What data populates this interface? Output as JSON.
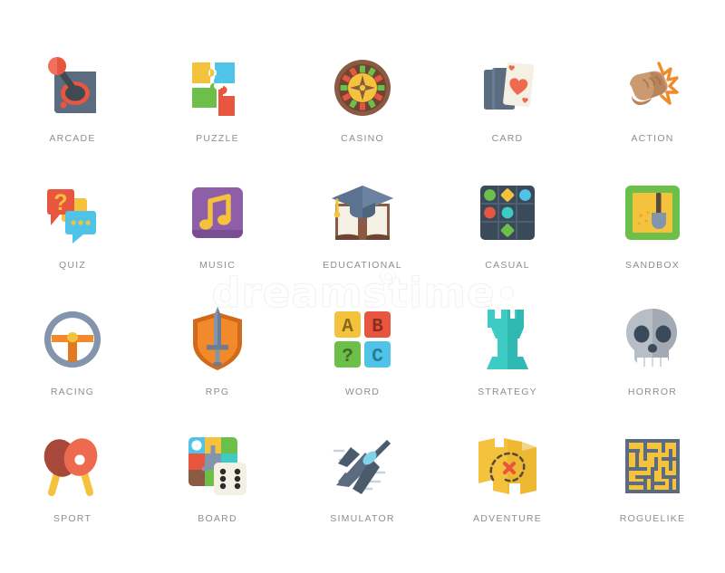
{
  "sheet": {
    "background": "#ffffff",
    "label_color": "#8e8e8e",
    "columns": 5,
    "rows": 4,
    "watermark": {
      "text": "dreamstime",
      "color": "#f2f2f2"
    }
  },
  "icons": [
    {
      "id": "arcade",
      "label": "ARCADE",
      "icon_name": "arcade-joystick-icon",
      "colors": [
        "#5b6b80",
        "#6e7f94",
        "#e8563f",
        "#f0705a",
        "#3f4a52"
      ]
    },
    {
      "id": "puzzle",
      "label": "PUZZLE",
      "icon_name": "puzzle-pieces-icon",
      "colors": [
        "#f4c23c",
        "#4fc3e8",
        "#6cc04a",
        "#e8563f"
      ]
    },
    {
      "id": "casino",
      "label": "CASINO",
      "icon_name": "casino-roulette-icon",
      "colors": [
        "#8a5a42",
        "#6f4432",
        "#f4c23c",
        "#6cc04a",
        "#e8563f"
      ]
    },
    {
      "id": "card",
      "label": "CARD",
      "icon_name": "playing-cards-icon",
      "colors": [
        "#5b6b80",
        "#f4f1e4",
        "#ee6a4e"
      ]
    },
    {
      "id": "action",
      "label": "ACTION",
      "icon_name": "punching-fist-icon",
      "colors": [
        "#cb9a70",
        "#b8845c",
        "#f08a2a"
      ]
    },
    {
      "id": "quiz",
      "label": "QUIZ",
      "icon_name": "quiz-speech-bubbles-icon",
      "colors": [
        "#e8563f",
        "#f4c23c",
        "#4fc3e8"
      ]
    },
    {
      "id": "music",
      "label": "MUSIC",
      "icon_name": "music-note-icon",
      "colors": [
        "#8e5ea8",
        "#7a4f92",
        "#f4c23c"
      ]
    },
    {
      "id": "educational",
      "label": "EDUCATIONAL",
      "icon_name": "graduation-cap-book-icon",
      "colors": [
        "#5b7390",
        "#8a5a42",
        "#f4f1e4",
        "#f4c23c"
      ]
    },
    {
      "id": "casual",
      "label": "CASUAL",
      "icon_name": "match-three-grid-icon",
      "colors": [
        "#3b4a5a",
        "#6cc04a",
        "#f4c23c",
        "#4fc3e8",
        "#e8563f",
        "#3ecbc4"
      ]
    },
    {
      "id": "sandbox",
      "label": "SANDBOX",
      "icon_name": "sandbox-shovel-icon",
      "colors": [
        "#6cc04a",
        "#f4c23c",
        "#5a4a3a"
      ]
    },
    {
      "id": "racing",
      "label": "RACING",
      "icon_name": "steering-wheel-icon",
      "colors": [
        "#97a8bd",
        "#8395ac",
        "#f08a2a",
        "#f4c23c"
      ]
    },
    {
      "id": "rpg",
      "label": "RPG",
      "icon_name": "sword-shield-icon",
      "colors": [
        "#f08a2a",
        "#d16a1c",
        "#8395ac",
        "#6b7d93"
      ]
    },
    {
      "id": "word",
      "label": "WORD",
      "icon_name": "letter-blocks-icon",
      "colors": [
        "#f4c23c",
        "#e8563f",
        "#6cc04a",
        "#4fc3e8"
      ]
    },
    {
      "id": "strategy",
      "label": "STRATEGY",
      "icon_name": "chess-rook-icon",
      "colors": [
        "#3ecbc4",
        "#2fb9b2"
      ]
    },
    {
      "id": "horror",
      "label": "HORROR",
      "icon_name": "skull-icon",
      "colors": [
        "#b8bec6",
        "#a3aab4",
        "#3b4a5a",
        "#ffffff"
      ]
    },
    {
      "id": "sport",
      "label": "SPORT",
      "icon_name": "ping-pong-paddles-icon",
      "colors": [
        "#a8483a",
        "#ee6a4e",
        "#f4c23c",
        "#ffffff"
      ]
    },
    {
      "id": "board",
      "label": "BOARD",
      "icon_name": "board-game-dice-icon",
      "colors": [
        "#4fc3e8",
        "#f4c23c",
        "#6cc04a",
        "#e8563f",
        "#8395ac",
        "#8a5a42",
        "#f4f1e4"
      ]
    },
    {
      "id": "simulator",
      "label": "SIMULATOR",
      "icon_name": "fighter-jet-icon",
      "colors": [
        "#4a5b6e",
        "#5b6b80",
        "#8395ac",
        "#7fd4e8"
      ]
    },
    {
      "id": "adventure",
      "label": "ADVENTURE",
      "icon_name": "treasure-map-icon",
      "colors": [
        "#f4c23c",
        "#e8b22c",
        "#e8563f",
        "#5a4a3a"
      ]
    },
    {
      "id": "roguelike",
      "label": "ROGUELIKE",
      "icon_name": "maze-icon",
      "colors": [
        "#f4c23c",
        "#5b6b80"
      ]
    }
  ]
}
